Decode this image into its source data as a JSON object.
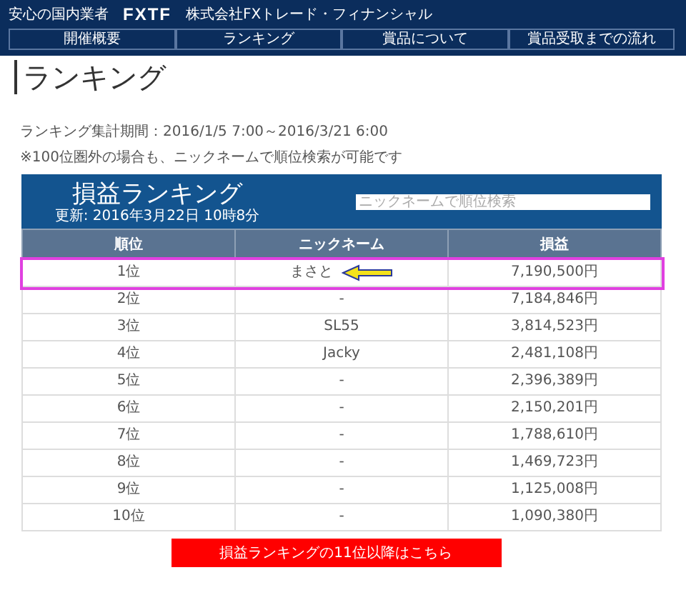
{
  "header": {
    "tagline": "安心の国内業者",
    "logo": "FXTF",
    "company": "株式会社FXトレード・フィナンシャル"
  },
  "nav": [
    {
      "label": "開催概要",
      "selected": false
    },
    {
      "label": "ランキング",
      "selected": false
    },
    {
      "label": "賞品について",
      "selected": false
    },
    {
      "label": "賞品受取までの流れ",
      "selected": false
    }
  ],
  "page_title": "ランキング",
  "period": "ランキング集計期間：2016/1/5 7:00～2016/3/21 6:00",
  "note": "※100位圏外の場合も、ニックネームで順位検索が可能です",
  "ranking": {
    "title": "損益ランキング",
    "updated": "更新: 2016年3月22日 10時8分",
    "search": {
      "placeholder": "ニックネームで順位検索"
    },
    "columns": [
      "順位",
      "ニックネーム",
      "損益"
    ],
    "rows": [
      {
        "rank": "1位",
        "nickname": "まさと",
        "profit": "7,190,500円",
        "highlighted": true
      },
      {
        "rank": "2位",
        "nickname": "-",
        "profit": "7,184,846円",
        "highlighted": false
      },
      {
        "rank": "3位",
        "nickname": "SL55",
        "profit": "3,814,523円",
        "highlighted": false
      },
      {
        "rank": "4位",
        "nickname": "Jacky",
        "profit": "2,481,108円",
        "highlighted": false
      },
      {
        "rank": "5位",
        "nickname": "-",
        "profit": "2,396,389円",
        "highlighted": false
      },
      {
        "rank": "6位",
        "nickname": "-",
        "profit": "2,150,201円",
        "highlighted": false
      },
      {
        "rank": "7位",
        "nickname": "-",
        "profit": "1,788,610円",
        "highlighted": false
      },
      {
        "rank": "8位",
        "nickname": "-",
        "profit": "1,469,723円",
        "highlighted": false
      },
      {
        "rank": "9位",
        "nickname": "-",
        "profit": "1,125,008円",
        "highlighted": false
      },
      {
        "rank": "10位",
        "nickname": "-",
        "profit": "1,090,380円",
        "highlighted": false
      }
    ]
  },
  "more_button": "損益ランキングの11位以降はこちら"
}
